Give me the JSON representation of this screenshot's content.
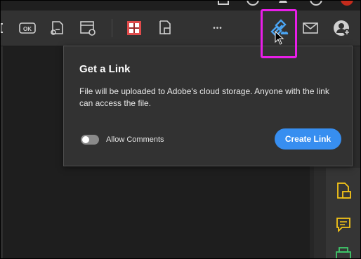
{
  "toolbar": {
    "icons": [
      "resize-icon",
      "ok-stamp-icon",
      "file-share-icon",
      "settings-window-icon",
      "redact-icon",
      "crop-icon",
      "more-icon",
      "share-link-icon",
      "email-icon",
      "add-user-icon"
    ],
    "ok_label": "OK",
    "more_label": "•••"
  },
  "popup": {
    "title": "Get a Link",
    "description": "File will be uploaded to Adobe's cloud storage. Anyone with the link can access the file.",
    "allow_comments_label": "Allow Comments",
    "allow_comments_enabled": true,
    "create_link_label": "Create Link"
  },
  "colors": {
    "accent": "#378ef0",
    "highlight": "#e81ee8",
    "link_icon": "#4aa3f0",
    "comment_icons": "#f5c518",
    "print_icon": "#3fc86a"
  },
  "right_pane_icons": [
    "file-note-icon",
    "comment-icon",
    "print-icon"
  ]
}
